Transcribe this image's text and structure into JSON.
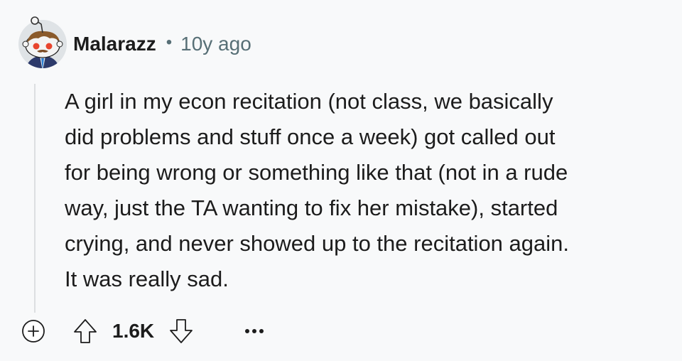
{
  "comment": {
    "author": "Malarazz",
    "separator": "•",
    "timestamp": "10y ago",
    "body": "A girl in my econ recitation (not class, we basically\ndid problems and stuff once a week) got called out\nfor being wrong or something like that (not in a rude\nway, just the TA wanting to fix her mistake), started\ncrying, and never showed up to the recitation again.\nIt was really sad.",
    "score": "1.6K"
  },
  "icons": {
    "avatar": "snoo-avatar",
    "expand": "plus-circle-icon",
    "upvote": "upvote-arrow-icon",
    "downvote": "downvote-arrow-icon",
    "more": "more-horizontal-icon"
  },
  "colors": {
    "background": "#f8f9fa",
    "text": "#1c1c1c",
    "meta": "#576f76",
    "thread_line": "#dcdfe1"
  }
}
